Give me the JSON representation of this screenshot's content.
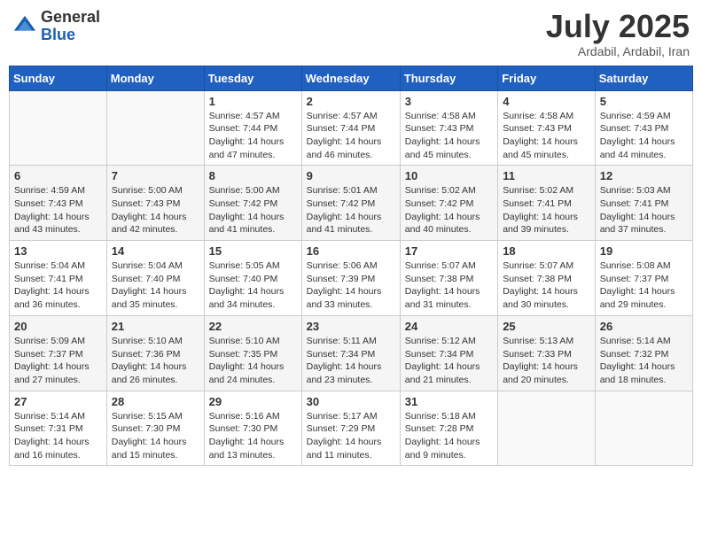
{
  "logo": {
    "general": "General",
    "blue": "Blue"
  },
  "header": {
    "month": "July 2025",
    "location": "Ardabil, Ardabil, Iran"
  },
  "weekdays": [
    "Sunday",
    "Monday",
    "Tuesday",
    "Wednesday",
    "Thursday",
    "Friday",
    "Saturday"
  ],
  "weeks": [
    [
      {
        "day": "",
        "sunrise": "",
        "sunset": "",
        "daylight": ""
      },
      {
        "day": "",
        "sunrise": "",
        "sunset": "",
        "daylight": ""
      },
      {
        "day": "1",
        "sunrise": "Sunrise: 4:57 AM",
        "sunset": "Sunset: 7:44 PM",
        "daylight": "Daylight: 14 hours and 47 minutes."
      },
      {
        "day": "2",
        "sunrise": "Sunrise: 4:57 AM",
        "sunset": "Sunset: 7:44 PM",
        "daylight": "Daylight: 14 hours and 46 minutes."
      },
      {
        "day": "3",
        "sunrise": "Sunrise: 4:58 AM",
        "sunset": "Sunset: 7:43 PM",
        "daylight": "Daylight: 14 hours and 45 minutes."
      },
      {
        "day": "4",
        "sunrise": "Sunrise: 4:58 AM",
        "sunset": "Sunset: 7:43 PM",
        "daylight": "Daylight: 14 hours and 45 minutes."
      },
      {
        "day": "5",
        "sunrise": "Sunrise: 4:59 AM",
        "sunset": "Sunset: 7:43 PM",
        "daylight": "Daylight: 14 hours and 44 minutes."
      }
    ],
    [
      {
        "day": "6",
        "sunrise": "Sunrise: 4:59 AM",
        "sunset": "Sunset: 7:43 PM",
        "daylight": "Daylight: 14 hours and 43 minutes."
      },
      {
        "day": "7",
        "sunrise": "Sunrise: 5:00 AM",
        "sunset": "Sunset: 7:43 PM",
        "daylight": "Daylight: 14 hours and 42 minutes."
      },
      {
        "day": "8",
        "sunrise": "Sunrise: 5:00 AM",
        "sunset": "Sunset: 7:42 PM",
        "daylight": "Daylight: 14 hours and 41 minutes."
      },
      {
        "day": "9",
        "sunrise": "Sunrise: 5:01 AM",
        "sunset": "Sunset: 7:42 PM",
        "daylight": "Daylight: 14 hours and 41 minutes."
      },
      {
        "day": "10",
        "sunrise": "Sunrise: 5:02 AM",
        "sunset": "Sunset: 7:42 PM",
        "daylight": "Daylight: 14 hours and 40 minutes."
      },
      {
        "day": "11",
        "sunrise": "Sunrise: 5:02 AM",
        "sunset": "Sunset: 7:41 PM",
        "daylight": "Daylight: 14 hours and 39 minutes."
      },
      {
        "day": "12",
        "sunrise": "Sunrise: 5:03 AM",
        "sunset": "Sunset: 7:41 PM",
        "daylight": "Daylight: 14 hours and 37 minutes."
      }
    ],
    [
      {
        "day": "13",
        "sunrise": "Sunrise: 5:04 AM",
        "sunset": "Sunset: 7:41 PM",
        "daylight": "Daylight: 14 hours and 36 minutes."
      },
      {
        "day": "14",
        "sunrise": "Sunrise: 5:04 AM",
        "sunset": "Sunset: 7:40 PM",
        "daylight": "Daylight: 14 hours and 35 minutes."
      },
      {
        "day": "15",
        "sunrise": "Sunrise: 5:05 AM",
        "sunset": "Sunset: 7:40 PM",
        "daylight": "Daylight: 14 hours and 34 minutes."
      },
      {
        "day": "16",
        "sunrise": "Sunrise: 5:06 AM",
        "sunset": "Sunset: 7:39 PM",
        "daylight": "Daylight: 14 hours and 33 minutes."
      },
      {
        "day": "17",
        "sunrise": "Sunrise: 5:07 AM",
        "sunset": "Sunset: 7:38 PM",
        "daylight": "Daylight: 14 hours and 31 minutes."
      },
      {
        "day": "18",
        "sunrise": "Sunrise: 5:07 AM",
        "sunset": "Sunset: 7:38 PM",
        "daylight": "Daylight: 14 hours and 30 minutes."
      },
      {
        "day": "19",
        "sunrise": "Sunrise: 5:08 AM",
        "sunset": "Sunset: 7:37 PM",
        "daylight": "Daylight: 14 hours and 29 minutes."
      }
    ],
    [
      {
        "day": "20",
        "sunrise": "Sunrise: 5:09 AM",
        "sunset": "Sunset: 7:37 PM",
        "daylight": "Daylight: 14 hours and 27 minutes."
      },
      {
        "day": "21",
        "sunrise": "Sunrise: 5:10 AM",
        "sunset": "Sunset: 7:36 PM",
        "daylight": "Daylight: 14 hours and 26 minutes."
      },
      {
        "day": "22",
        "sunrise": "Sunrise: 5:10 AM",
        "sunset": "Sunset: 7:35 PM",
        "daylight": "Daylight: 14 hours and 24 minutes."
      },
      {
        "day": "23",
        "sunrise": "Sunrise: 5:11 AM",
        "sunset": "Sunset: 7:34 PM",
        "daylight": "Daylight: 14 hours and 23 minutes."
      },
      {
        "day": "24",
        "sunrise": "Sunrise: 5:12 AM",
        "sunset": "Sunset: 7:34 PM",
        "daylight": "Daylight: 14 hours and 21 minutes."
      },
      {
        "day": "25",
        "sunrise": "Sunrise: 5:13 AM",
        "sunset": "Sunset: 7:33 PM",
        "daylight": "Daylight: 14 hours and 20 minutes."
      },
      {
        "day": "26",
        "sunrise": "Sunrise: 5:14 AM",
        "sunset": "Sunset: 7:32 PM",
        "daylight": "Daylight: 14 hours and 18 minutes."
      }
    ],
    [
      {
        "day": "27",
        "sunrise": "Sunrise: 5:14 AM",
        "sunset": "Sunset: 7:31 PM",
        "daylight": "Daylight: 14 hours and 16 minutes."
      },
      {
        "day": "28",
        "sunrise": "Sunrise: 5:15 AM",
        "sunset": "Sunset: 7:30 PM",
        "daylight": "Daylight: 14 hours and 15 minutes."
      },
      {
        "day": "29",
        "sunrise": "Sunrise: 5:16 AM",
        "sunset": "Sunset: 7:30 PM",
        "daylight": "Daylight: 14 hours and 13 minutes."
      },
      {
        "day": "30",
        "sunrise": "Sunrise: 5:17 AM",
        "sunset": "Sunset: 7:29 PM",
        "daylight": "Daylight: 14 hours and 11 minutes."
      },
      {
        "day": "31",
        "sunrise": "Sunrise: 5:18 AM",
        "sunset": "Sunset: 7:28 PM",
        "daylight": "Daylight: 14 hours and 9 minutes."
      },
      {
        "day": "",
        "sunrise": "",
        "sunset": "",
        "daylight": ""
      },
      {
        "day": "",
        "sunrise": "",
        "sunset": "",
        "daylight": ""
      }
    ]
  ]
}
